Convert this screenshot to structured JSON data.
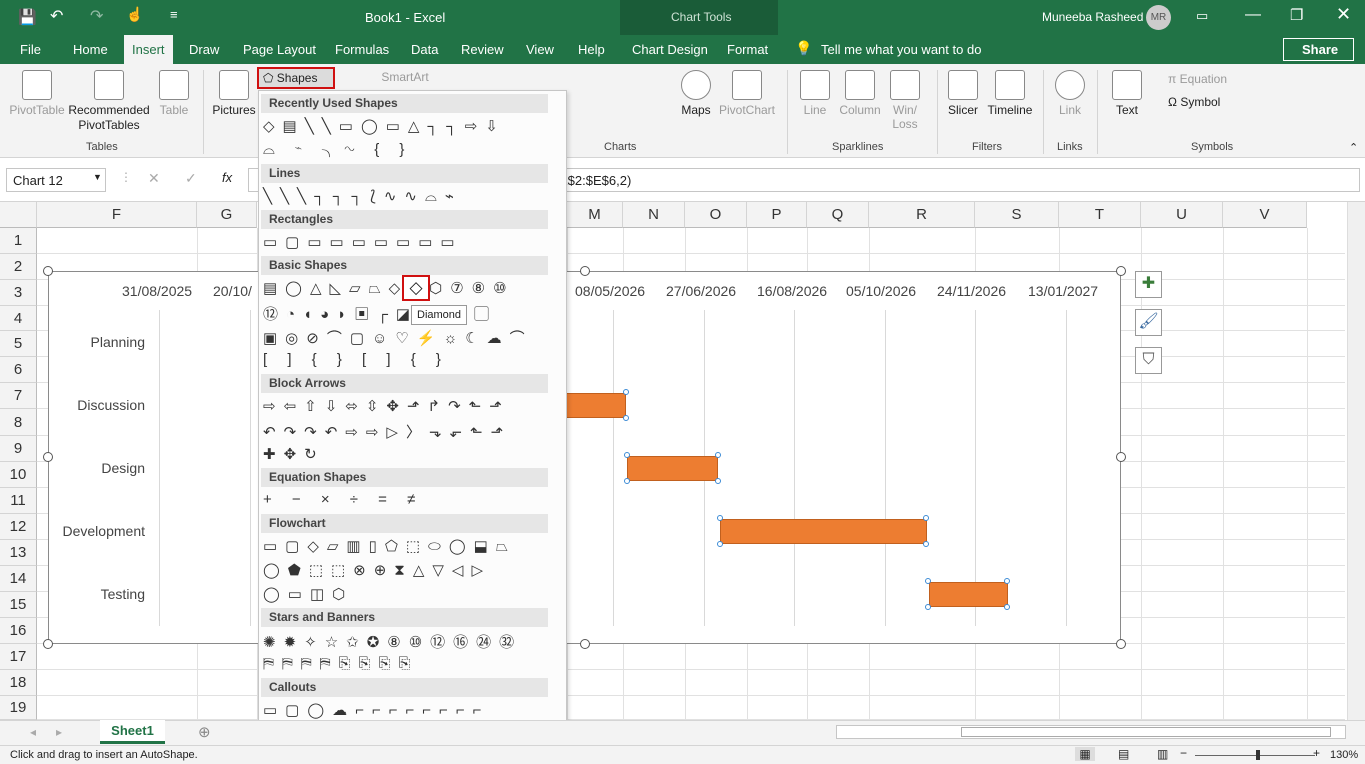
{
  "window": {
    "doc_title": "Book1 - Excel",
    "context": "Chart Tools",
    "user": "Muneeba Rasheed",
    "user_initials": "MR"
  },
  "tabs": [
    "File",
    "Home",
    "Insert",
    "Draw",
    "Page Layout",
    "Formulas",
    "Data",
    "Review",
    "View",
    "Help",
    "Chart Design",
    "Format"
  ],
  "tell_me": "Tell me what you want to do",
  "share": "Share",
  "ribbon": {
    "pivot": "PivotTable",
    "recommended_pivot": "Recommended PivotTables",
    "table": "Table",
    "group_tables": "Tables",
    "pictures": "Pictures",
    "shapes": "Shapes",
    "smartart": "SmartArt",
    "maps": "Maps",
    "pivotchart": "PivotChart",
    "group_charts": "Charts",
    "line": "Line",
    "column": "Column",
    "winloss": "Win/ Loss",
    "group_sparklines": "Sparklines",
    "slicer": "Slicer",
    "timeline": "Timeline",
    "group_filters": "Filters",
    "link": "Link",
    "group_links": "Links",
    "text": "Text",
    "equation": "Equation",
    "symbol": "Symbol",
    "group_symbols": "Symbols"
  },
  "namebox": "Chart 12",
  "formula": "E$2:$E$6,2)",
  "columns": [
    "F",
    "G",
    "M",
    "N",
    "O",
    "P",
    "Q",
    "R",
    "S",
    "T",
    "U",
    "V"
  ],
  "rows": [
    "1",
    "2",
    "3",
    "4",
    "5",
    "6",
    "7",
    "8",
    "9",
    "10",
    "11",
    "12",
    "13",
    "14",
    "15",
    "16",
    "17",
    "18",
    "19"
  ],
  "chart_data": {
    "type": "bar",
    "date_ticks": [
      "31/08/2025",
      "20/10/",
      "08/05/2026",
      "27/06/2026",
      "16/08/2026",
      "05/10/2026",
      "24/11/2026",
      "13/01/2027"
    ],
    "categories": [
      "Planning",
      "Discussion",
      "Design",
      "Development",
      "Testing"
    ]
  },
  "dropdown": {
    "button": "Shapes",
    "sections": [
      "Recently Used Shapes",
      "Lines",
      "Rectangles",
      "Basic Shapes",
      "Block Arrows",
      "Equation Shapes",
      "Flowchart",
      "Stars and Banners",
      "Callouts"
    ],
    "tooltip": "Diamond",
    "rows": {
      "recent1": "◇▤╲╲▭◯▭△┐┐⇨⇩",
      "recent2": "⌓ ⌁ ╮∿ { }",
      "lines": "╲╲╲┐┐┐⟅∿∿⌓⌁",
      "rect": "▭▢▭▭▭▭▭▭▭",
      "basic1": "▤◯△◺▱⏢◇⬠⬡⑦⑧⑩",
      "basic2": "⑫◔◖◕◗▣┌◪ ⬚⬭▢",
      "basic3": "▣◎⊘⌒▢☺♡⚡☼☾☁⌒",
      "basic4": "[ ] { } [ ] { }",
      "ba1": "⇨⇦⇧⇩⬄⇳✥⬏↱↷⬑⬏",
      "ba2": "↶↷↷↶⇨⇨▷〉⬎⬐⬑⬏",
      "ba3": "✚✥↻",
      "eq": "+ − × ÷ = ≠",
      "fc1": "▭▢◇▱▥▯⬠⬚⬭◯⬓⏢",
      "fc2": "◯⬟⬚⬚⊗⊕⧗△▽◁▷",
      "fc3": "◯▭◫⬡",
      "sb1": "✺✹✧☆✩✪⑧⑩⑫⑯㉔㉜",
      "sb2": "⛿⛿⛿⛿⎘⎘⎘⎘",
      "co1": "▭▢◯☁⌐⌐⌐⌐⌐⌐⌐⌐",
      "co2": "⌐⌐⌐⌐"
    }
  },
  "sheet": "Sheet1",
  "status": "Click and drag to insert an AutoShape.",
  "zoom": "130%"
}
